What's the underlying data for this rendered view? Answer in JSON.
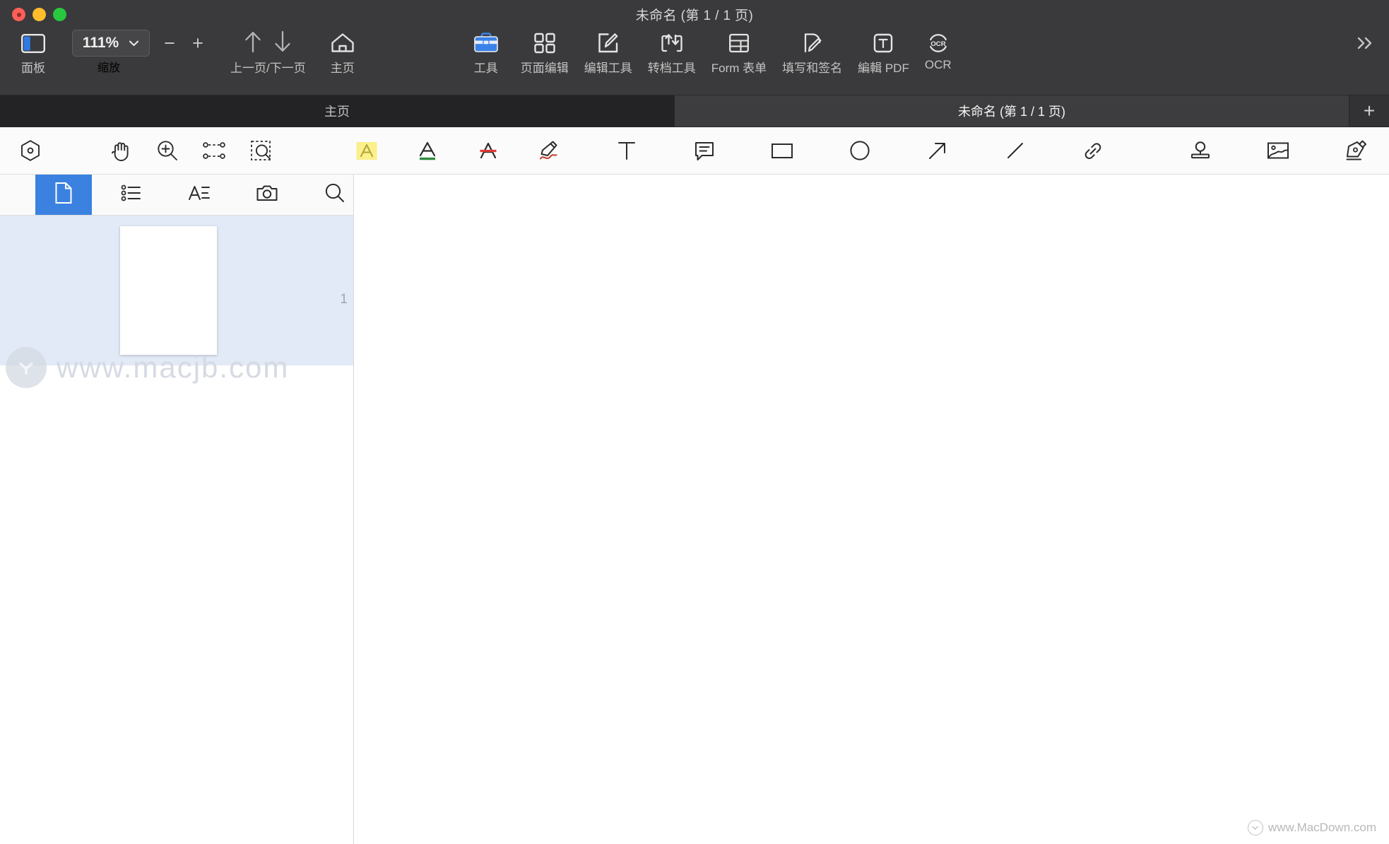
{
  "window": {
    "title": "未命名 (第 1 / 1 页)",
    "traffic": {
      "close": "close-button",
      "minimize": "minimize-button",
      "maximize": "maximize-button"
    }
  },
  "toolbar": {
    "panel": {
      "label": "面板",
      "icon": "sidebar-panel-icon"
    },
    "zoom": {
      "value": "111%",
      "label": "缩放",
      "minus": "−",
      "plus": "+",
      "chevron": "chevron-down-icon"
    },
    "page_nav": {
      "label": "上一页/下一页",
      "up_icon": "arrow-up-icon",
      "down_icon": "arrow-down-icon"
    },
    "home": {
      "label": "主页",
      "icon": "home-icon"
    },
    "tools": {
      "label": "工具",
      "icon": "briefcase-icon",
      "accent": "#2f7ae5"
    },
    "page_edit": {
      "label": "页面编辑",
      "icon": "grid-four-icon"
    },
    "edit_tools": {
      "label": "编辑工具",
      "icon": "pencil-square-icon"
    },
    "convert": {
      "label": "转档工具",
      "icon": "convert-arrows-icon"
    },
    "form": {
      "label": "Form 表单",
      "icon": "form-table-icon"
    },
    "fill_sign": {
      "label": "填写和签名",
      "icon": "fill-sign-icon"
    },
    "edit_pdf": {
      "label": "編輯 PDF",
      "icon": "text-box-icon"
    },
    "ocr": {
      "label": "OCR",
      "icon": "ocr-circle-icon"
    },
    "overflow": {
      "label": "≫",
      "icon": "chevron-double-right-icon"
    }
  },
  "tabs": {
    "items": [
      {
        "label": "主页",
        "active": false
      },
      {
        "label": "未命名 (第 1 / 1 页)",
        "active": true
      }
    ],
    "add_label": "+"
  },
  "annotation_toolbar": {
    "tools": [
      {
        "name": "select-hexagon-icon",
        "title": "选择"
      },
      {
        "name": "hand-icon",
        "title": "手型工具"
      },
      {
        "name": "zoom-in-icon",
        "title": "放大"
      },
      {
        "name": "marquee-select-icon",
        "title": "区域选择"
      },
      {
        "name": "area-zoom-icon",
        "title": "区域缩放"
      },
      {
        "name": "highlight-icon",
        "title": "高亮",
        "color": "#fbf08a"
      },
      {
        "name": "underline-icon",
        "title": "下划线",
        "color": "#2f8b3c"
      },
      {
        "name": "strikethrough-icon",
        "title": "删除线",
        "color": "#e03b34"
      },
      {
        "name": "pencil-draw-icon",
        "title": "铅笔",
        "color": "#c0392b"
      },
      {
        "name": "text-icon",
        "title": "文字"
      },
      {
        "name": "comment-icon",
        "title": "注释"
      },
      {
        "name": "rectangle-icon",
        "title": "矩形"
      },
      {
        "name": "circle-icon",
        "title": "椭圆"
      },
      {
        "name": "arrow-icon",
        "title": "箭头"
      },
      {
        "name": "line-icon",
        "title": "直线"
      },
      {
        "name": "link-icon",
        "title": "链接"
      },
      {
        "name": "stamp-icon",
        "title": "图章"
      },
      {
        "name": "image-icon",
        "title": "图片"
      },
      {
        "name": "signature-icon",
        "title": "签名"
      },
      {
        "name": "table-icon",
        "title": "表格"
      }
    ]
  },
  "sidebar": {
    "tabs": [
      {
        "name": "page-thumbnail-tab",
        "icon": "page-icon",
        "active": true
      },
      {
        "name": "outline-tab",
        "icon": "bullet-list-icon",
        "active": false
      },
      {
        "name": "annotations-tab",
        "icon": "text-lines-icon",
        "active": false
      },
      {
        "name": "snapshot-tab",
        "icon": "camera-icon",
        "active": false
      },
      {
        "name": "search-tab",
        "icon": "search-icon",
        "active": false
      }
    ],
    "thumbnails": [
      {
        "page_number": "1",
        "selected": true
      }
    ]
  },
  "watermark": {
    "text": "www.macjb.com",
    "logo": "download-circle-icon"
  },
  "footer": {
    "brand": "www.MacDown.com",
    "logo": "macdown-circle-icon"
  }
}
